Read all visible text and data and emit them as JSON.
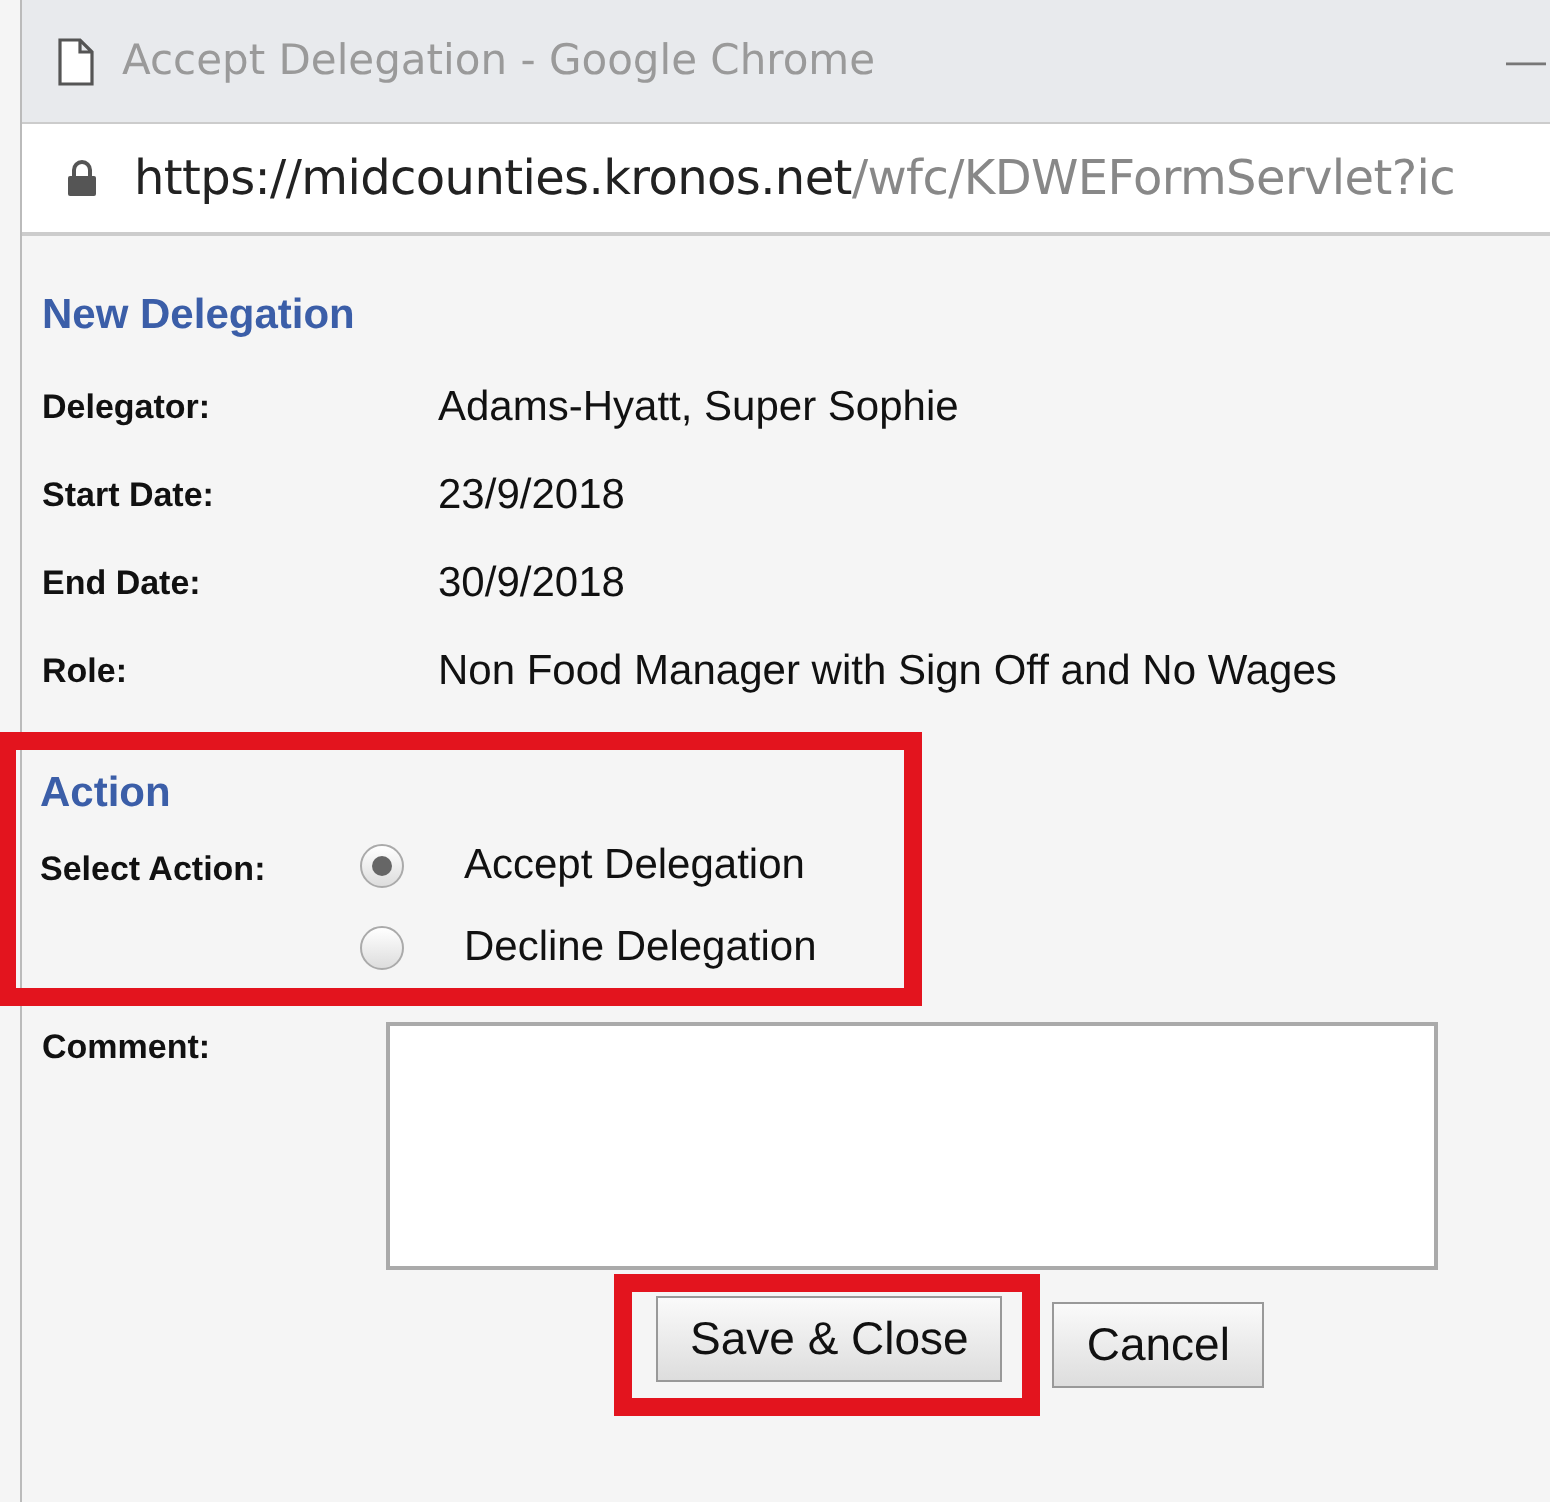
{
  "window": {
    "title": "Accept Delegation - Google Chrome",
    "minimize": "—"
  },
  "address_bar": {
    "host": "https://midcounties.kronos.net",
    "path": "/wfc/KDWEFormServlet?ic"
  },
  "delegation": {
    "heading": "New Delegation",
    "fields": [
      {
        "label": "Delegator:",
        "value": "Adams-Hyatt, Super Sophie"
      },
      {
        "label": "Start Date:",
        "value": "23/9/2018"
      },
      {
        "label": "End Date:",
        "value": "30/9/2018"
      },
      {
        "label": "Role:",
        "value": "Non Food Manager with Sign Off and No Wages"
      }
    ]
  },
  "action": {
    "heading": "Action",
    "highlighted": true,
    "label": "Select Action:",
    "options": [
      {
        "label": "Accept Delegation",
        "selected": true
      },
      {
        "label": "Decline Delegation",
        "selected": false
      }
    ]
  },
  "comment": {
    "label": "Comment:"
  },
  "buttons": [
    {
      "label": "Save & Close",
      "highlighted": true
    },
    {
      "label": "Cancel",
      "highlighted": false
    }
  ]
}
